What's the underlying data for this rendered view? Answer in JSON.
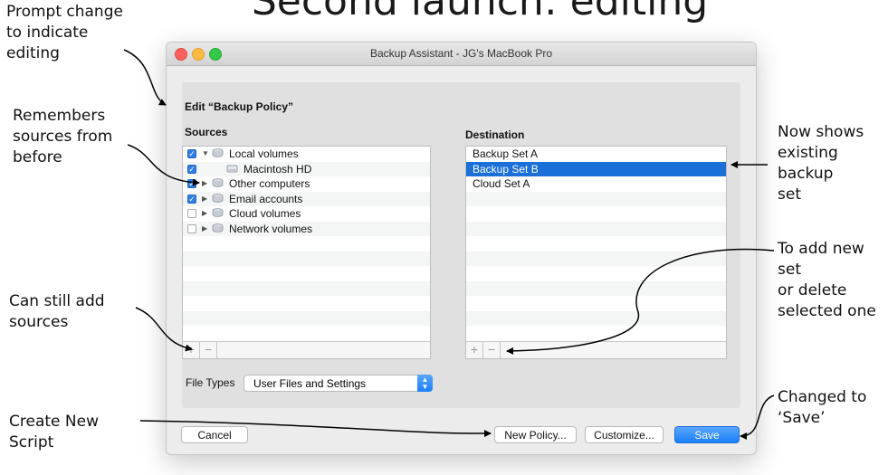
{
  "slide": {
    "title": "Second launch: editing",
    "annotations": {
      "prompt_change": [
        "Prompt change",
        "to indicate",
        "editing"
      ],
      "remembers_sources": [
        "Remembers",
        "sources from",
        "before"
      ],
      "can_add_sources": [
        "Can still add",
        "sources"
      ],
      "create_new_script": [
        "Create New",
        "Script"
      ],
      "existing_backup": [
        "Now shows",
        "existing backup",
        "set"
      ],
      "add_or_delete": [
        "To add new set",
        "or delete",
        "selected one"
      ],
      "changed_to_save": [
        "Changed to",
        "‘Save’"
      ]
    }
  },
  "window": {
    "title": "Backup Assistant - JG's MacBook Pro",
    "heading": "Edit “Backup Policy”",
    "sources_label": "Sources",
    "destination_label": "Destination",
    "sources": [
      {
        "label": "Local volumes",
        "checked": true,
        "expander": "open",
        "icon": "volume-group-icon"
      },
      {
        "label": "Macintosh HD",
        "checked": true,
        "expander": "none",
        "icon": "hard-drive-icon"
      },
      {
        "label": "Other computers",
        "checked": true,
        "expander": "closed",
        "icon": "volume-group-icon"
      },
      {
        "label": "Email accounts",
        "checked": true,
        "expander": "closed",
        "icon": "volume-group-icon"
      },
      {
        "label": "Cloud volumes",
        "checked": false,
        "expander": "closed",
        "icon": "volume-group-icon"
      },
      {
        "label": "Network volumes",
        "checked": false,
        "expander": "closed",
        "icon": "volume-group-icon"
      }
    ],
    "destinations": [
      {
        "label": "Backup Set A",
        "selected": false
      },
      {
        "label": "Backup Set B",
        "selected": true
      },
      {
        "label": "Cloud Set A",
        "selected": false
      }
    ],
    "add_symbol": "+",
    "remove_symbol": "−",
    "file_types_label": "File Types",
    "file_types_value": "User Files and Settings",
    "buttons": {
      "cancel": "Cancel",
      "new_policy": "New Policy...",
      "customize": "Customize...",
      "save": "Save"
    },
    "colors": {
      "selection": "#1a6fd8",
      "checkbox": "#2f7de1",
      "close": "#fc605c",
      "minimize": "#fdbc40",
      "zoom": "#34c84a"
    }
  }
}
